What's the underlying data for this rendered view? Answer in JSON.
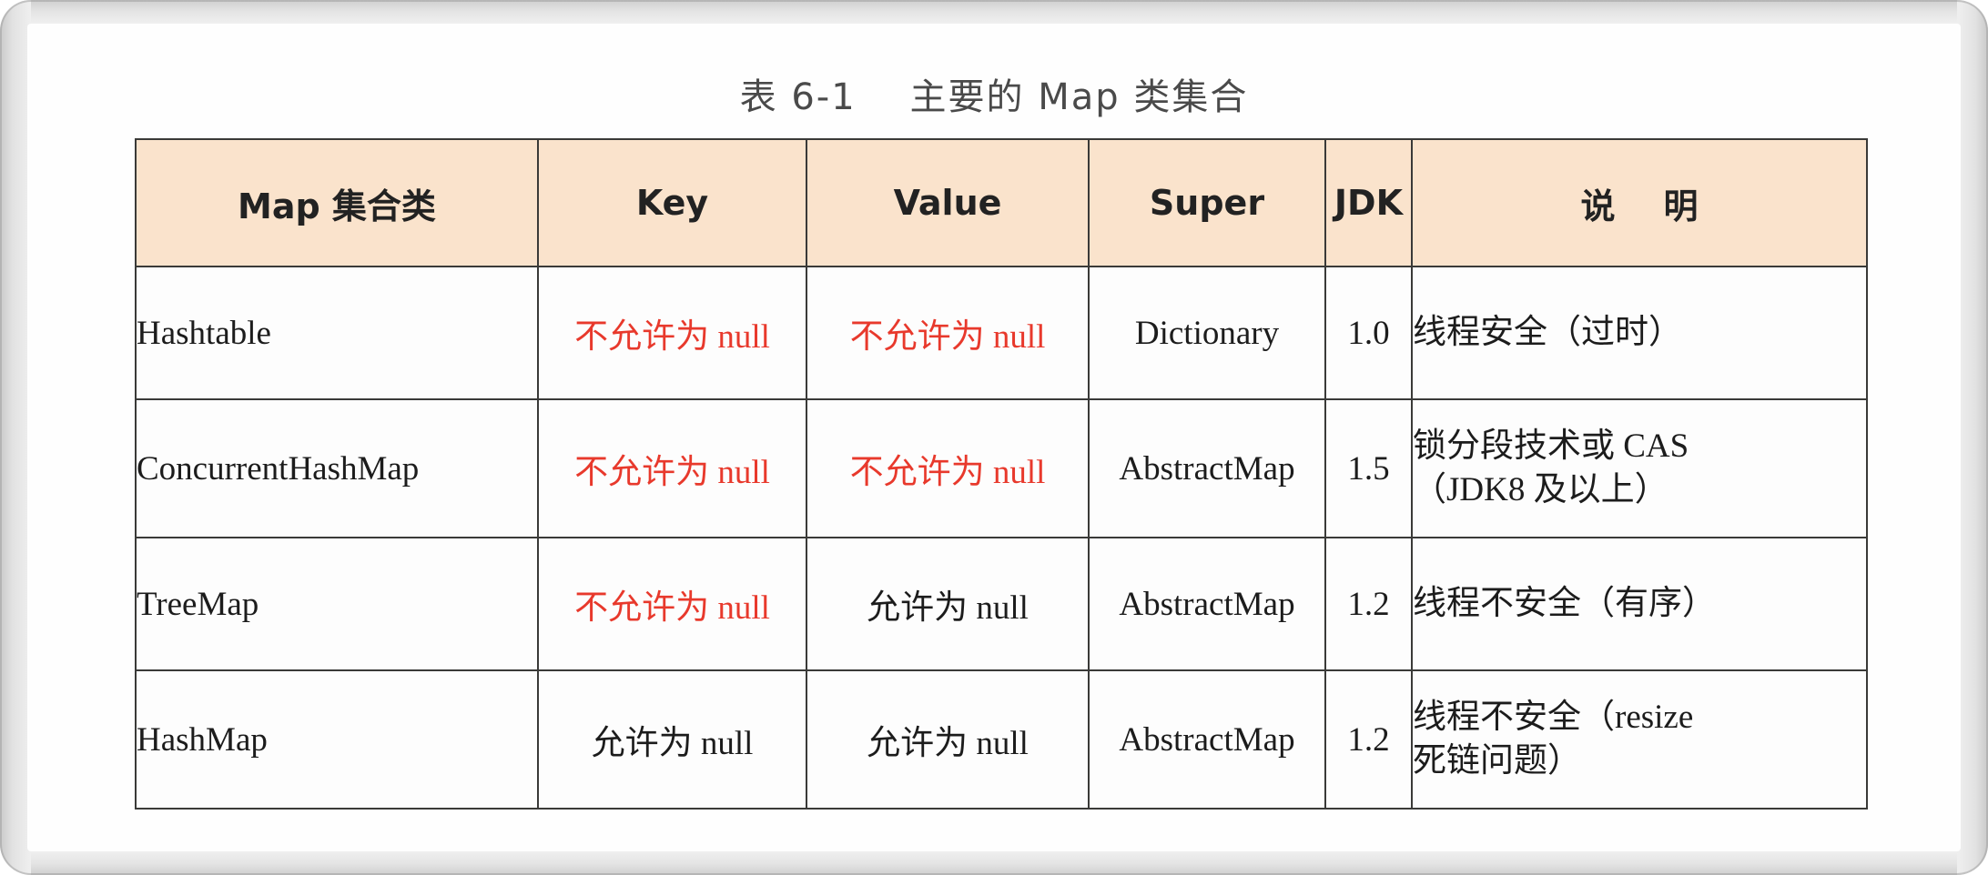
{
  "caption": "表 6-1    主要的 Map 类集合",
  "table": {
    "headers": {
      "class": "Map 集合类",
      "key": "Key",
      "value": "Value",
      "super": "Super",
      "jdk": "JDK",
      "desc": "说    明"
    },
    "rows": [
      {
        "class": "Hashtable",
        "key": "不允许为 null",
        "key_color": "#e8392c",
        "value": "不允许为 null",
        "value_color": "#e8392c",
        "super": "Dictionary",
        "jdk": "1.0",
        "desc": "线程安全（过时）"
      },
      {
        "class": "ConcurrentHashMap",
        "key": "不允许为 null",
        "key_color": "#e8392c",
        "value": "不允许为 null",
        "value_color": "#e8392c",
        "super": "AbstractMap",
        "jdk": "1.5",
        "desc": "锁分段技术或 CAS\n（JDK8 及以上）"
      },
      {
        "class": "TreeMap",
        "key": "不允许为 null",
        "key_color": "#e8392c",
        "value": "允许为 null",
        "value_color": "#1c1c1c",
        "super": "AbstractMap",
        "jdk": "1.2",
        "desc": "线程不安全（有序）"
      },
      {
        "class": "HashMap",
        "key": "允许为 null",
        "key_color": "#1c1c1c",
        "value": "允许为 null",
        "value_color": "#1c1c1c",
        "super": "AbstractMap",
        "jdk": "1.2",
        "desc": "线程不安全（resize\n死链问题）"
      }
    ]
  },
  "colors": {
    "header_background": "#fae3cc",
    "border": "#3a3a38",
    "null_not_allowed": "#e8392c",
    "text": "#1c1c1c",
    "page_background": "#fefefe",
    "frame": "#e8e8e8"
  }
}
